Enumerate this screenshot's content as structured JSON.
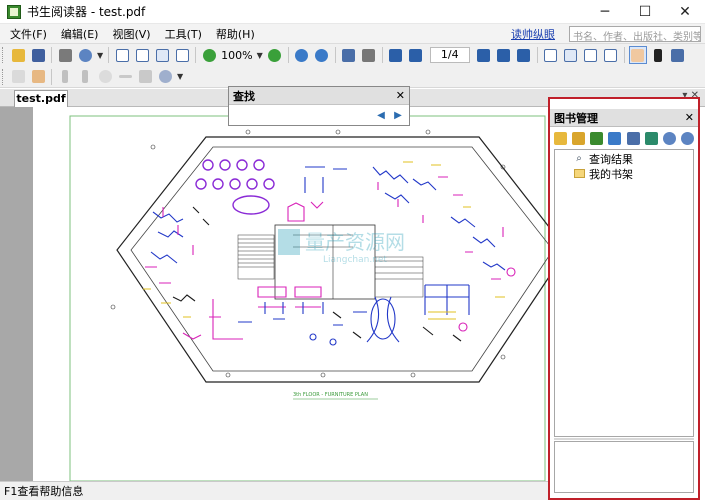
{
  "window": {
    "title": "书生阅读器 - test.pdf",
    "controls": {
      "minimize": "─",
      "maximize": "☐",
      "close": "✕"
    }
  },
  "menu": {
    "items": [
      "文件(F)",
      "编辑(E)",
      "视图(V)",
      "工具(T)",
      "帮助(H)"
    ],
    "right_link": "读帅纵眼",
    "search_placeholder": "书名、作者、出版社、类别等"
  },
  "toolbar": {
    "zoom": "100%",
    "page_indicator": "1/4",
    "dropdown_arrow": "▼",
    "icons": {
      "open": "open-folder-icon",
      "save": "save-icon",
      "print": "print-icon",
      "find": "search-icon",
      "zoom_out": "zoom-out-icon",
      "zoom_in": "zoom-in-icon",
      "first": "first-page-icon",
      "prev": "prev-page-icon",
      "next": "next-page-icon",
      "last": "last-page-icon",
      "hand": "hand-tool-icon",
      "select": "select-arrow-icon"
    },
    "colors": {
      "zoom_circle": "#3aa03a",
      "page_icon": "#4a6ea8",
      "nav": "#2b5fa8"
    }
  },
  "tabs": {
    "active": "test.pdf",
    "controls": "▾ ✕"
  },
  "find_panel": {
    "title": "查找",
    "close": "✕",
    "prev_icon": "◀",
    "next_icon": "▶"
  },
  "library": {
    "title": "图书管理",
    "close": "✕",
    "tree": [
      {
        "label": "查询结果",
        "icon": "search-results-icon"
      },
      {
        "label": "我的书架",
        "icon": "bookshelf-folder-icon"
      }
    ],
    "highlight_color": "#c0202a"
  },
  "status": {
    "text": "F1查看帮助信息"
  },
  "document": {
    "plan_caption": "3th FLOOR - FURNITURE PLAN"
  }
}
